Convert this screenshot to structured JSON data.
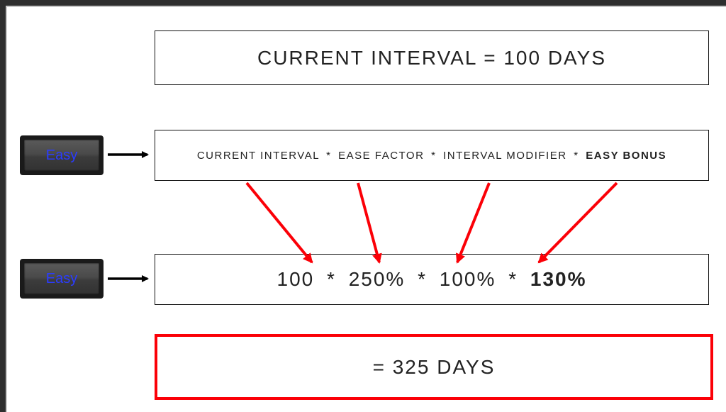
{
  "title": "CURRENT INTERVAL = 100 DAYS",
  "easy_label": "Easy",
  "formula": {
    "p1": "CURRENT INTERVAL",
    "p2": "EASE FACTOR",
    "p3": "INTERVAL MODIFIER",
    "p4": "EASY BONUS"
  },
  "values": {
    "v1": "100",
    "v2": "250%",
    "v3": "100%",
    "v4": "130%"
  },
  "result": "= 325 DAYS",
  "star": "*"
}
